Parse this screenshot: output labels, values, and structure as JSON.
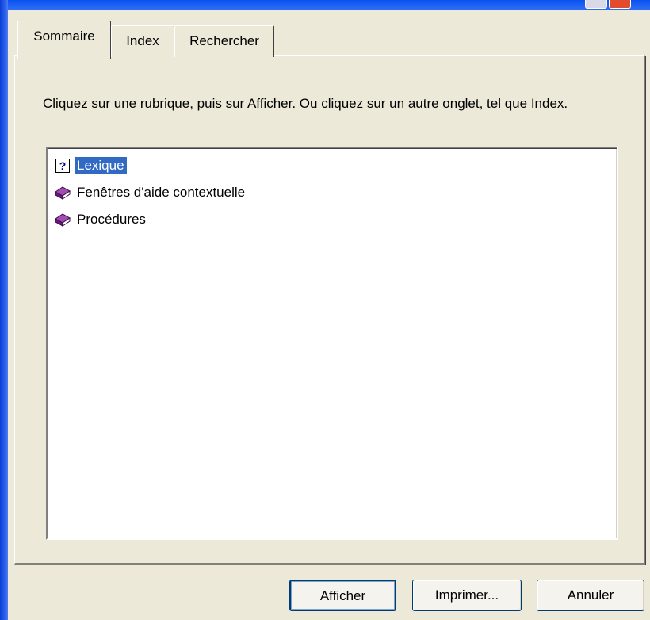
{
  "tabs": [
    {
      "label": "Sommaire",
      "active": true
    },
    {
      "label": "Index",
      "active": false
    },
    {
      "label": "Rechercher",
      "active": false
    }
  ],
  "instruction": "Cliquez sur une rubrique, puis sur Afficher. Ou cliquez sur un autre onglet, tel que Index.",
  "tree": [
    {
      "label": "Lexique",
      "icon": "help-topic-icon",
      "selected": true
    },
    {
      "label": "Fenêtres d'aide contextuelle",
      "icon": "closed-book-icon",
      "selected": false
    },
    {
      "label": "Procédures",
      "icon": "closed-book-icon",
      "selected": false
    }
  ],
  "buttons": {
    "display": "Afficher",
    "print": "Imprimer...",
    "cancel": "Annuler"
  },
  "colors": {
    "selection": "#316ac5",
    "book": "#7a2a8a",
    "window_blue": "#0a52ef"
  }
}
